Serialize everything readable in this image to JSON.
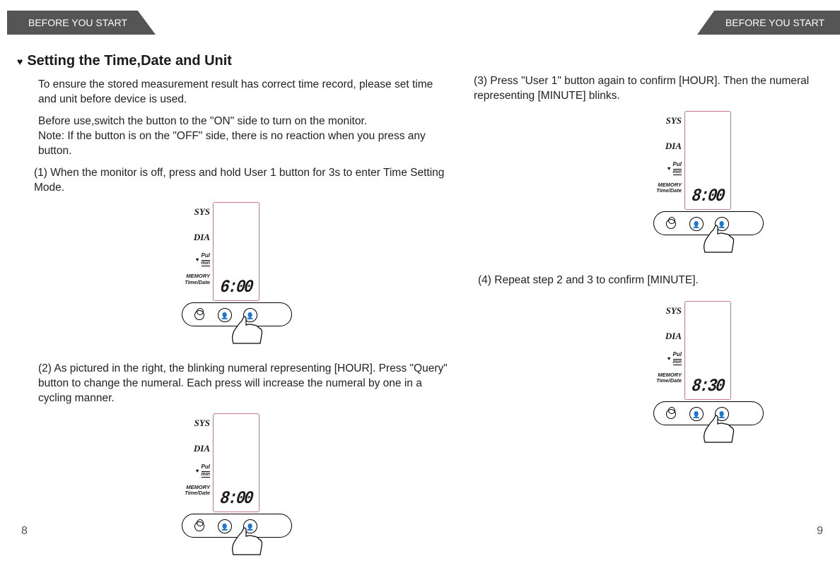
{
  "header": {
    "left_tab": "BEFORE YOU START",
    "right_tab": "BEFORE YOU START"
  },
  "section_title": "Setting the Time,Date and Unit",
  "left": {
    "intro": "To ensure the stored measurement result has correct time record, please set time and unit before device is used.",
    "note": "Before use,switch the button to the \"ON\" side to turn on the monitor.\nNote: If the button is on the \"OFF\" side, there is no reaction when you press any button.",
    "step1": "(1) When the monitor is off, press and hold User 1 button for 3s to enter Time Setting Mode.",
    "step2": "(2) As pictured in the right, the blinking numeral representing [HOUR]. Press \"Query\" button to change the numeral. Each press will increase the numeral by one in a cycling manner."
  },
  "right": {
    "step3": "(3) Press \"User 1\" button again to confirm [HOUR]. Then the numeral representing [MINUTE] blinks.",
    "step4": "(4) Repeat step 2 and 3 to confirm [MINUTE]."
  },
  "device_labels": {
    "sys": "SYS",
    "dia": "DIA",
    "pul": "Pul",
    "min": "min",
    "memory": "MEMORY",
    "timedate": "Time/Date"
  },
  "displays": {
    "d1": "6:00",
    "d2": "8:00",
    "d3": "8:00",
    "d4": "8:30"
  },
  "page_numbers": {
    "left": "8",
    "right": "9"
  }
}
